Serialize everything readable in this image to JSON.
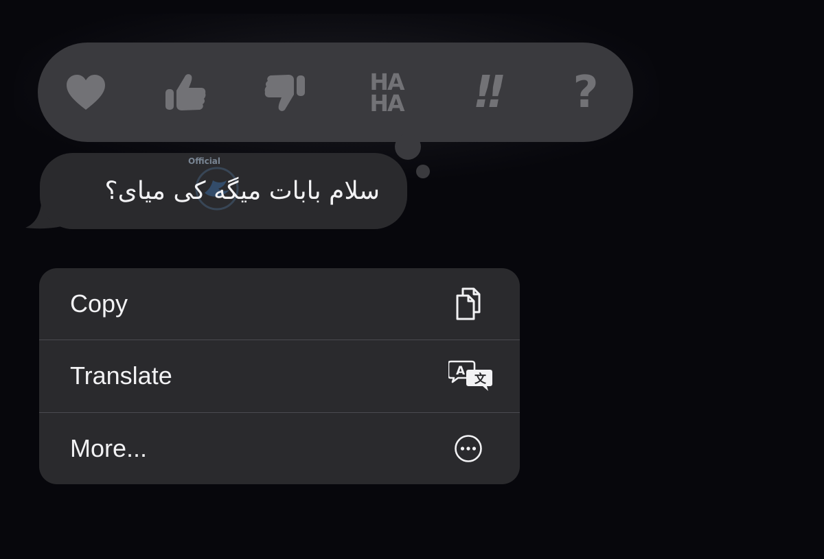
{
  "reactions": {
    "items": [
      {
        "name": "heart",
        "icon": "heart-icon"
      },
      {
        "name": "thumbs-up",
        "icon": "thumbs-up-icon"
      },
      {
        "name": "thumbs-down",
        "icon": "thumbs-down-icon"
      },
      {
        "name": "haha",
        "icon": "haha-icon",
        "line1": "HA",
        "line2": "HA"
      },
      {
        "name": "emphasize",
        "icon": "double-exclamation-icon",
        "text": "!!"
      },
      {
        "name": "question",
        "icon": "question-mark-icon",
        "text": "?"
      }
    ],
    "icon_color": "#727276",
    "background": "#3a3a3e"
  },
  "message": {
    "text": "سلام بابات میگه کی میای؟",
    "bubble_color": "#2a2a2d",
    "watermark_text": "Official"
  },
  "context_menu": {
    "items": [
      {
        "label": "Copy",
        "icon": "copy-icon"
      },
      {
        "label": "Translate",
        "icon": "translate-icon"
      },
      {
        "label": "More...",
        "icon": "ellipsis-circle-icon"
      }
    ],
    "background": "#2a2a2d",
    "text_color": "#f2f2f4"
  }
}
